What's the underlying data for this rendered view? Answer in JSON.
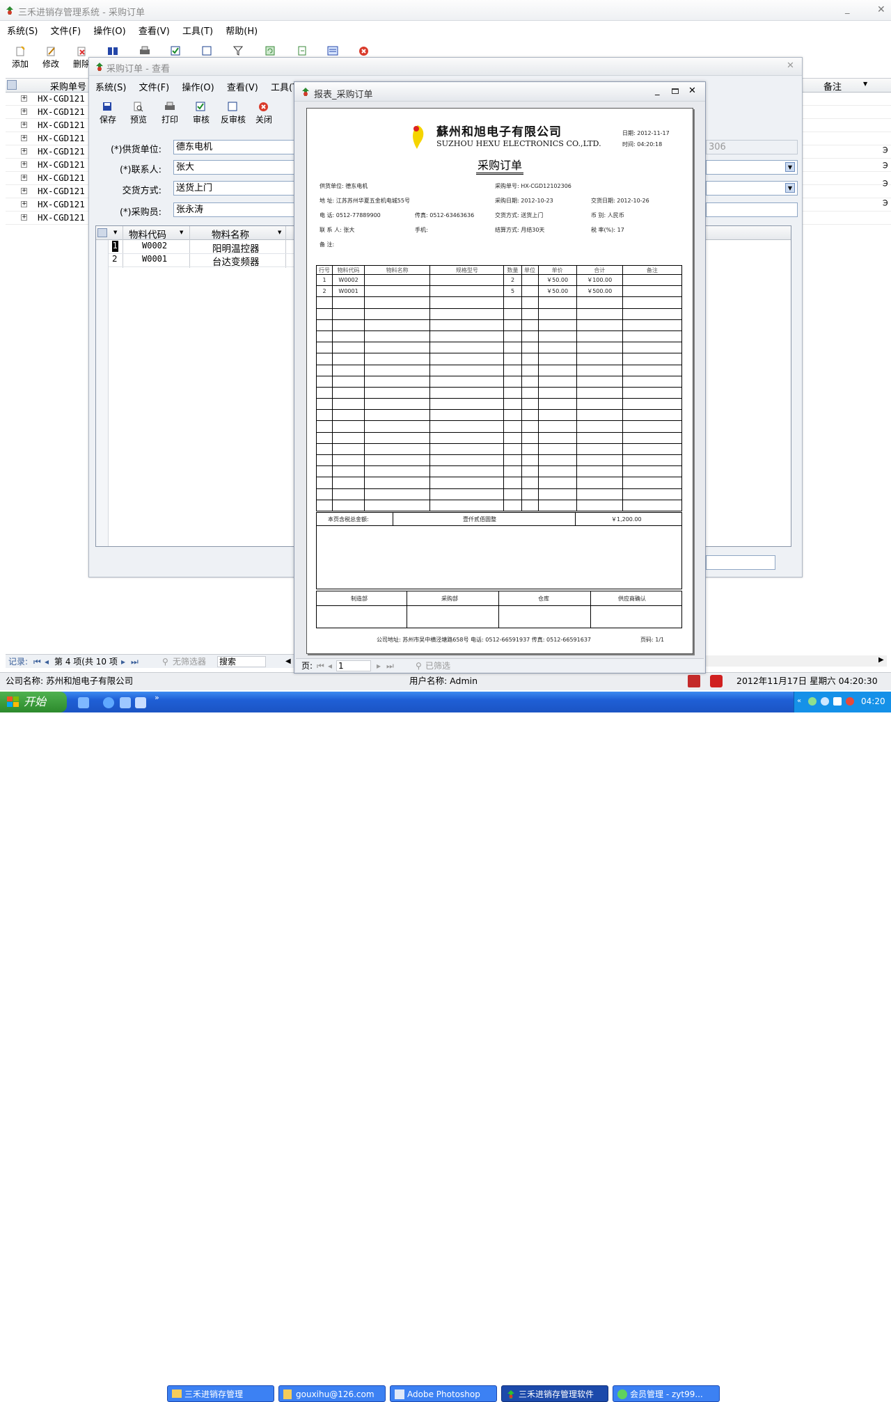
{
  "main": {
    "title": "三禾进销存管理系统 - 采购订单",
    "menu": [
      "系统(S)",
      "文件(F)",
      "操作(O)",
      "查看(V)",
      "工具(T)",
      "帮助(H)"
    ],
    "toolbar": [
      "添加",
      "修改",
      "删除"
    ],
    "col_order_no": "采购单号",
    "col_remark": "备注",
    "rows": [
      "HX-CGD121",
      "HX-CGD121",
      "HX-CGD121",
      "HX-CGD121",
      "HX-CGD121",
      "HX-CGD121",
      "HX-CGD121",
      "HX-CGD121",
      "HX-CGD121",
      "HX-CGD121"
    ],
    "nav": {
      "record_label": "记录:",
      "position": "第 4 项(共 10 项",
      "filter": "无筛选器",
      "search": "搜索"
    },
    "status": {
      "company": "公司名称: 苏州和旭电子有限公司",
      "user": "用户名称: Admin",
      "datetime": "2012年11月17日 星期六 04:20:30"
    }
  },
  "view": {
    "title": "采购订单 - 查看",
    "menu": [
      "系统(S)",
      "文件(F)",
      "操作(O)",
      "查看(V)",
      "工具(T)"
    ],
    "toolbar": [
      "保存",
      "预览",
      "打印",
      "审核",
      "反审核",
      "关闭"
    ],
    "labels": {
      "supplier": "(*)供货单位:",
      "contact": "(*)联系人:",
      "delivery": "交货方式:",
      "buyer": "(*)采购员:"
    },
    "values": {
      "supplier": "德东电机",
      "contact": "张大",
      "delivery": "送货上门",
      "buyer": "张永涛",
      "order_frag": "306"
    },
    "grid": {
      "col_code": "物料代码",
      "col_name": "物料名称",
      "rows": [
        {
          "idx": "1",
          "code": "W0002",
          "name": "阳明温控器"
        },
        {
          "idx": "2",
          "code": "W0001",
          "name": "台达变频器"
        }
      ]
    }
  },
  "report": {
    "title": "报表_采购订单",
    "company_cn": "蘇州和旭电子有限公司",
    "company_en": "SUZHOU HEXU ELECTRONICS CO.,LTD.",
    "date": "日期: 2012-11-17",
    "time": "时间: 04:20:18",
    "doc_title": "采购订单",
    "info": {
      "supplier": "供货单位: 德东电机",
      "order_no": "采购单号: HX-CGD12102306",
      "address": "地    址: 江苏苏州华夏五金机电城55号",
      "order_date": "采购日期: 2012-10-23",
      "delivery_date": "交货日期: 2012-10-26",
      "phone": "电    话: 0512-77889900",
      "fax": "传真: 0512-63463636",
      "delivery": "交货方式: 送货上门",
      "currency": "币    别: 人民币",
      "contact": "联 系 人: 张大",
      "mobile": "手机:",
      "settle": "结算方式: 月结30天",
      "tax": "税 率(%): 17",
      "remark": "备    注:"
    },
    "headers": [
      "行号",
      "物料代码",
      "物料名称",
      "规格型号",
      "数量",
      "单位",
      "单价",
      "合计",
      "备注"
    ],
    "items": [
      {
        "no": "1",
        "code": "W0002",
        "qty": "2",
        "price": "￥50.00",
        "total": "￥100.00"
      },
      {
        "no": "2",
        "code": "W0001",
        "qty": "5",
        "price": "￥50.00",
        "total": "￥500.00"
      }
    ],
    "total_label": "本页含税总金额:",
    "total_words": "壹仟贰佰圆整",
    "total_value": "￥1,200.00",
    "signs": [
      "制造部",
      "采购部",
      "仓库",
      "供应商确认"
    ],
    "footer": "公司地址: 苏州市吴中横泾塘路658号  电话: 0512-66591937  传真: 0512-66591637",
    "pages": "页码: 1/1",
    "page_label": "页:",
    "page_value": "1",
    "filtered": "已筛选"
  },
  "taskbar": {
    "start": "开始",
    "items": [
      "三禾进销存管理",
      "gouxihu@126.com",
      "Adobe Photoshop",
      "三禾进销存管理软件",
      "会员管理 - zyt99..."
    ],
    "clock": "04:20"
  }
}
